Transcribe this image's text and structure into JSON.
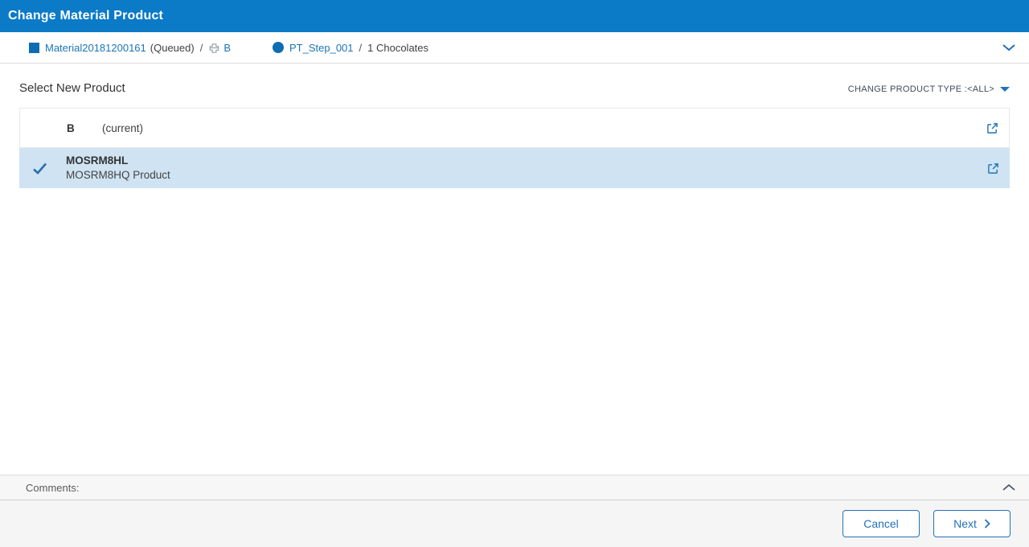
{
  "header": {
    "title": "Change Material Product"
  },
  "breadcrumb": {
    "material": {
      "name": "Material20181200161",
      "status": "(Queued)",
      "separator": "/",
      "sub_name": "B"
    },
    "step": {
      "name": "PT_Step_001",
      "separator": "/",
      "detail": "1 Chocolates"
    }
  },
  "main": {
    "heading": "Select New Product",
    "product_type_filter_label": "CHANGE PRODUCT TYPE :<ALL>",
    "products": [
      {
        "name": "B",
        "note": "(current)",
        "selected": false
      },
      {
        "name": "MOSRM8HL",
        "description": "MOSRM8HQ Product",
        "selected": true
      }
    ]
  },
  "comments": {
    "label": "Comments:"
  },
  "footer": {
    "cancel_label": "Cancel",
    "next_label": "Next"
  },
  "icons": {
    "breadcrumb_material": "blue-square",
    "breadcrumb_sub": "pallet-plus",
    "breadcrumb_step": "blue-circle",
    "breadcrumb_collapse": "chevron-down",
    "selected_row": "checkmark",
    "row_action": "external-link",
    "filter": "caret-down",
    "comments_collapse": "chevron-up",
    "next_button": "chevron-right"
  },
  "colors": {
    "header_background": "#0b7ac7",
    "accent_blue": "#2272b9",
    "link_blue": "#1b74b8",
    "selected_row_background": "#cfe3f3",
    "comments_background": "#f7f7f7",
    "footer_background": "#f5f5f5"
  }
}
